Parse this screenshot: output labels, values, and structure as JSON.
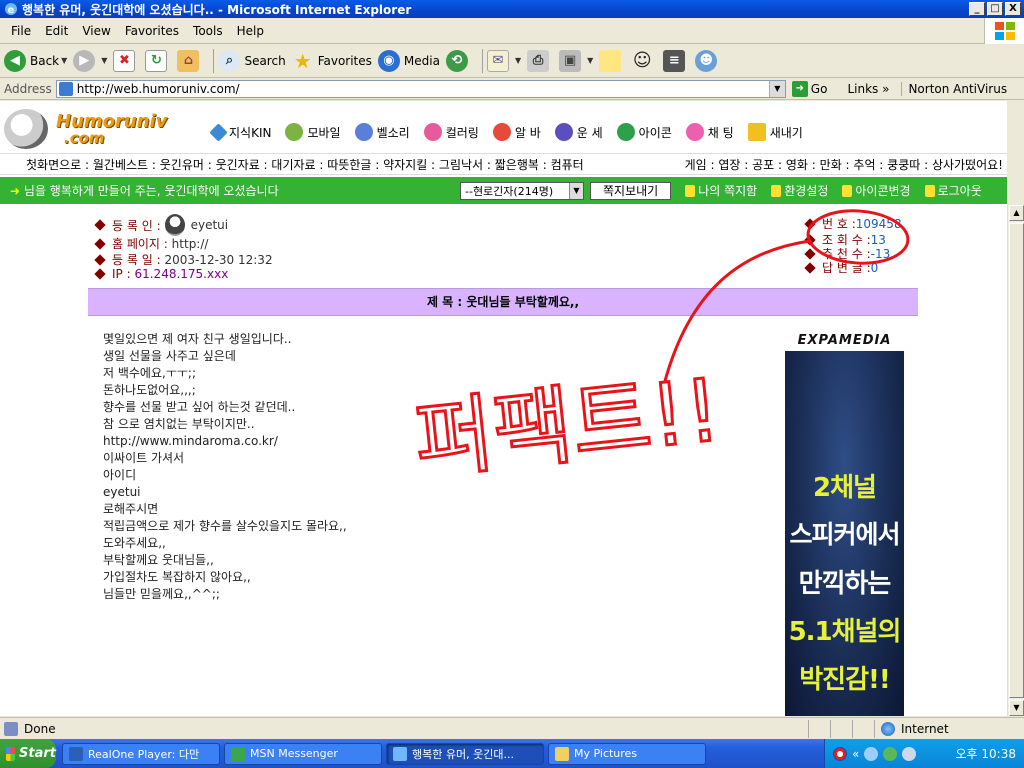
{
  "window": {
    "title": "행복한 유머, 웃긴대학에 오셨습니다.. - Microsoft Internet Explorer",
    "minimize": "_",
    "maximize": "□",
    "close": "X"
  },
  "menu": [
    "File",
    "Edit",
    "View",
    "Favorites",
    "Tools",
    "Help"
  ],
  "toolbar": {
    "back": "Back",
    "search": "Search",
    "favorites": "Favorites",
    "media": "Media"
  },
  "address": {
    "label": "Address",
    "url": "http://web.humoruniv.com/",
    "go": "Go",
    "links": "Links",
    "links_chevron": "»",
    "antivirus": "Norton AntiVirus"
  },
  "site": {
    "logo_main": "Humoruniv",
    "logo_sub": ".com",
    "nav": [
      "지식KIN",
      "모바일",
      "벨소리",
      "컬러링",
      "알 바",
      "운 세",
      "아이콘",
      "채 팅",
      "새내기"
    ],
    "subnav_left": "첫화면으로 : 월간베스트 : 웃긴유머 : 웃긴자료 : 대기자료 : 따뜻한글 : 약자지킬 : 그림낙서 : 짧은행복 : 컴퓨터",
    "subnav_right": "게임 : 엽장 : 공포 : 영화 : 만화 : 추억 : 쿵쿵따 : 상사가떴어요!",
    "welcome": "님을 행복하게 만들어 주는, 웃긴대학에 오셨습니다",
    "welcome_arrow": "➜",
    "online_select": "--현로긴자(214명)",
    "send_message": "쪽지보내기",
    "my_messages": "나의 쪽지함",
    "settings": "환경설정",
    "icon_change": "아이콘변경",
    "logout": "로그아웃"
  },
  "post": {
    "author_label": "등 록 인 :",
    "author": "eyetui",
    "homepage_label": "홈 페이지 :",
    "homepage": "http://",
    "date_label": "등 록 일 :",
    "date": "2003-12-30 12:32",
    "ip_label": "IP :",
    "ip": "61.248.175.xxx",
    "number_label": "번     호 :",
    "number": "109458",
    "views_label": "조 회 수 :",
    "views": "13",
    "recommend_label": "추 천 수 :",
    "recommend": "-13",
    "replies_label": "답 변 글 :",
    "replies": "0",
    "subject": "제 목 : 웃대님들 부탁할께요,,",
    "body": [
      "몇일있으면 제 여자 친구 생일입니다..",
      "생일 선물을 사주고 싶은데",
      "저 백수에요,ㅜㅜ;;",
      "돈하나도없어요,,,;",
      "향수를 선물 받고 싶어 하는것 같던데..",
      "참 으로 염치없는 부탁이지만..",
      "http://www.mindaroma.co.kr/",
      "이싸이트 가셔서",
      "아이디",
      "eyetui",
      "로해주시면",
      "적립금액으로 제가 향수를 살수있을지도 몰라요,,",
      "도와주세요,,",
      "부탁할께요 웃대님들,,",
      "가입절차도 복잡하지 않아요,,",
      "님들만 믿을께요,,^^;;"
    ]
  },
  "ad": {
    "brand": "EXPAMEDIA",
    "lines": [
      "2채널",
      "스피커에서",
      "만끽하는",
      "5.1채널의",
      "박진감!!"
    ]
  },
  "annotation": {
    "handwriting": "퍼팩트!!",
    "color": "#e8141a"
  },
  "status": {
    "text": "Done",
    "zone": "Internet"
  },
  "taskbar": {
    "start": "Start",
    "tasks": [
      "RealOne Player: 다만",
      "MSN Messenger",
      "행복한 유머, 웃긴대...",
      "My Pictures"
    ],
    "tray_chevron": "«",
    "clock": "오후 10:38"
  }
}
